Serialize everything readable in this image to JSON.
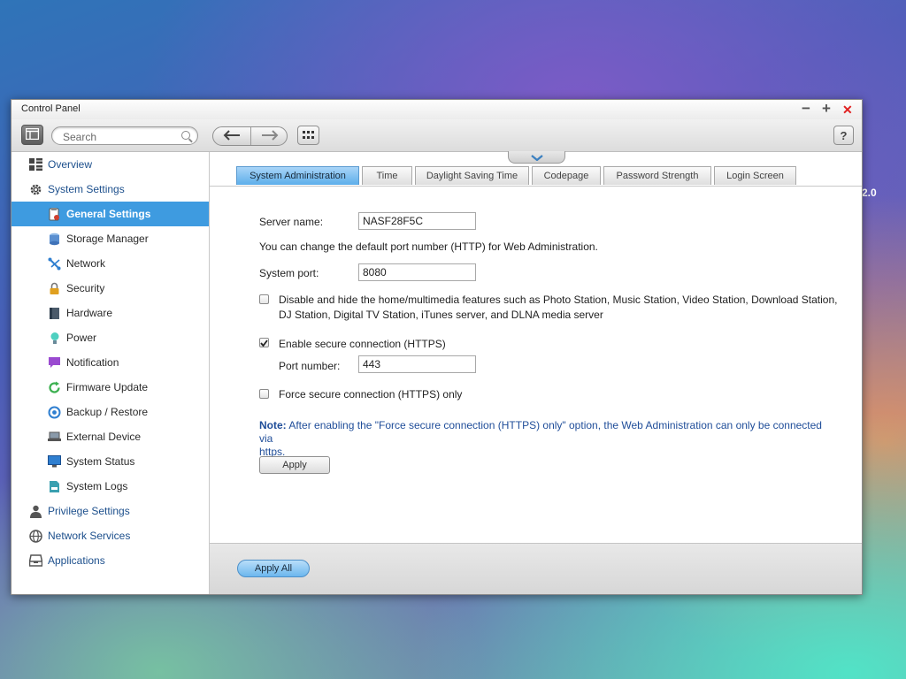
{
  "desktop": {
    "edge_text": "2.0"
  },
  "window": {
    "title": "Control Panel",
    "controls": {
      "minimize": "−",
      "maximize": "+",
      "close": "✕"
    }
  },
  "toolbar": {
    "search_placeholder": "Search",
    "help_label": "?"
  },
  "sidebar": {
    "items": [
      {
        "label": "Overview",
        "icon": "overview-grid-icon",
        "level": "top"
      },
      {
        "label": "System Settings",
        "icon": "gear-icon",
        "level": "top"
      },
      {
        "label": "General Settings",
        "icon": "general-settings-icon",
        "level": "sub",
        "active": true
      },
      {
        "label": "Storage Manager",
        "icon": "database-icon",
        "level": "sub"
      },
      {
        "label": "Network",
        "icon": "network-icon",
        "level": "sub"
      },
      {
        "label": "Security",
        "icon": "lock-icon",
        "level": "sub"
      },
      {
        "label": "Hardware",
        "icon": "hardware-icon",
        "level": "sub"
      },
      {
        "label": "Power",
        "icon": "bulb-icon",
        "level": "sub"
      },
      {
        "label": "Notification",
        "icon": "chat-bubble-icon",
        "level": "sub"
      },
      {
        "label": "Firmware Update",
        "icon": "refresh-icon",
        "level": "sub"
      },
      {
        "label": "Backup / Restore",
        "icon": "backup-icon",
        "level": "sub"
      },
      {
        "label": "External Device",
        "icon": "external-device-icon",
        "level": "sub"
      },
      {
        "label": "System Status",
        "icon": "monitor-icon",
        "level": "sub"
      },
      {
        "label": "System Logs",
        "icon": "log-file-icon",
        "level": "sub"
      },
      {
        "label": "Privilege Settings",
        "icon": "user-icon",
        "level": "top"
      },
      {
        "label": "Network Services",
        "icon": "globe-icon",
        "level": "top"
      },
      {
        "label": "Applications",
        "icon": "applications-icon",
        "level": "top"
      }
    ]
  },
  "tabs": [
    {
      "label": "System Administration",
      "active": true
    },
    {
      "label": "Time"
    },
    {
      "label": "Daylight Saving Time"
    },
    {
      "label": "Codepage"
    },
    {
      "label": "Password Strength"
    },
    {
      "label": "Login Screen"
    }
  ],
  "form": {
    "server_name_label": "Server name:",
    "server_name_value": "NASF28F5C",
    "port_hint": "You can change the default port number (HTTP) for Web Administration.",
    "system_port_label": "System port:",
    "system_port_value": "8080",
    "disable_multimedia_line1": "Disable and hide the home/multimedia features such as Photo Station, Music Station, Video Station, Download Station,",
    "disable_multimedia_line2": "DJ Station, Digital TV Station, iTunes server, and DLNA media server",
    "disable_multimedia_checked": false,
    "enable_https_label": "Enable secure connection (HTTPS)",
    "enable_https_checked": true,
    "port_number_label": "Port number:",
    "port_number_value": "443",
    "force_https_label": "Force secure connection (HTTPS) only",
    "force_https_checked": false,
    "note_prefix": "Note:",
    "note_line1": " After enabling the \"Force secure connection (HTTPS) only\" option, the Web Administration can only be connected via",
    "note_line2": "https.",
    "apply_label": "Apply"
  },
  "footer": {
    "apply_all_label": "Apply All"
  }
}
